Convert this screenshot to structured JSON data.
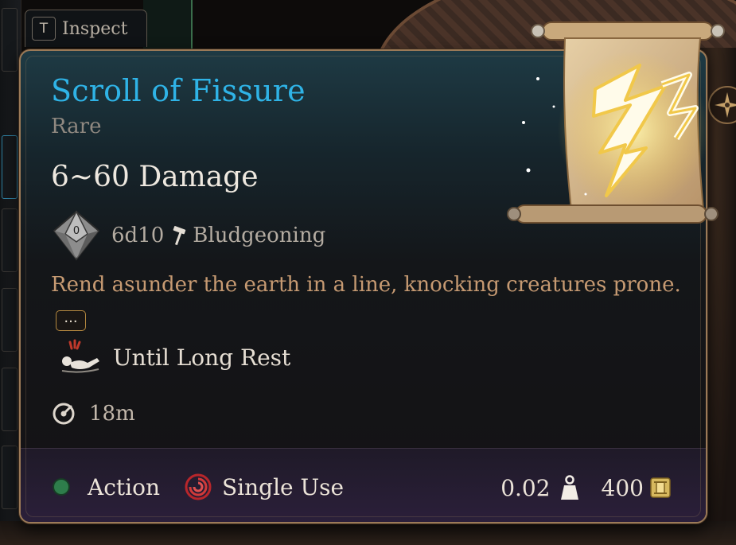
{
  "inspect": {
    "key": "T",
    "label": "Inspect"
  },
  "item": {
    "name": "Scroll of Fissure",
    "rarity": "Rare",
    "damage": "6~60 Damage",
    "dice": "6d10",
    "damage_type": "Bludgeoning",
    "description": "Rend asunder the earth in a line, knocking creatures prone.",
    "more_label": "...",
    "condition": "Until Long Rest",
    "range": "18m",
    "action": "Action",
    "usage": "Single Use",
    "weight": "0.02",
    "value": "400",
    "die_face": "0"
  },
  "colors": {
    "title": "#2fb3e6",
    "rarity": "#8f8880",
    "description": "#c69a72",
    "action_dot": "#2e7d4b",
    "border": "#9b7a58",
    "gold": "#d6b85e"
  },
  "icons": {
    "die": "d10-die-icon",
    "hammer": "bludgeoning-hammer-icon",
    "condition": "prone-icon",
    "range": "range-icon",
    "action": "action-dot-icon",
    "usage": "single-use-swirl-icon",
    "weight": "weight-icon",
    "gold": "gold-coin-icon",
    "compass": "compass-icon",
    "scroll": "scroll-lightning-icon"
  }
}
